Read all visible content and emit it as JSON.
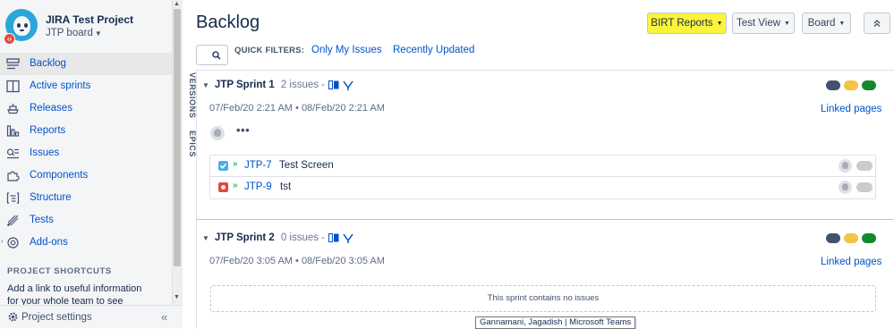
{
  "project": {
    "name": "JIRA Test Project",
    "board": "JTP board",
    "badge_icon": "code-badge"
  },
  "sidebar": {
    "items": [
      {
        "label": "Backlog",
        "icon": "backlog-icon",
        "active": true
      },
      {
        "label": "Active sprints",
        "icon": "board-columns-icon"
      },
      {
        "label": "Releases",
        "icon": "ship-icon"
      },
      {
        "label": "Reports",
        "icon": "chart-icon"
      },
      {
        "label": "Issues",
        "icon": "issues-search-icon"
      },
      {
        "label": "Components",
        "icon": "puzzle-icon"
      },
      {
        "label": "Structure",
        "icon": "structure-icon"
      },
      {
        "label": "Tests",
        "icon": "test-tube-icon"
      },
      {
        "label": "Add-ons",
        "icon": "addon-icon"
      }
    ],
    "shortcuts_heading": "PROJECT SHORTCUTS",
    "shortcuts_text": "Add a link to useful information for your whole team to see",
    "footer_label": "Project settings",
    "collapse_glyph": "«"
  },
  "main": {
    "title": "Backlog",
    "toolbar": {
      "birt_label": "BIRT Reports",
      "testview_label": "Test View",
      "board_label": "Board",
      "collapse_glyph": "⌃⌃"
    },
    "quick_filters": {
      "label": "QUICK FILTERS:",
      "items": [
        "Only My Issues",
        "Recently Updated"
      ]
    },
    "side_tabs": [
      "VERSIONS",
      "EPICS"
    ],
    "sprints": [
      {
        "name": "JTP Sprint 1",
        "count": "2 issues",
        "sep": "-",
        "start": "07/Feb/20 2:21 AM",
        "end": "08/Feb/20 2:21 AM",
        "date_sep": "•",
        "linked": "Linked pages",
        "more": "•••",
        "issues": [
          {
            "key": "JTP-7",
            "summary": "Test Screen",
            "type": "task",
            "type_color": "#4bade8"
          },
          {
            "key": "JTP-9",
            "summary": "tst",
            "type": "bug",
            "type_color": "#e5493a"
          }
        ]
      },
      {
        "name": "JTP Sprint 2",
        "count": "0 issues",
        "sep": "-",
        "start": "07/Feb/20 3:05 AM",
        "end": "08/Feb/20 3:05 AM",
        "date_sep": "•",
        "linked": "Linked pages",
        "empty_text": "This sprint contains no issues"
      }
    ],
    "status_colors": [
      "#42526e",
      "#f6c342",
      "#14892c"
    ]
  },
  "tooltip": "Gannamani, Jagadish | Microsoft Teams"
}
